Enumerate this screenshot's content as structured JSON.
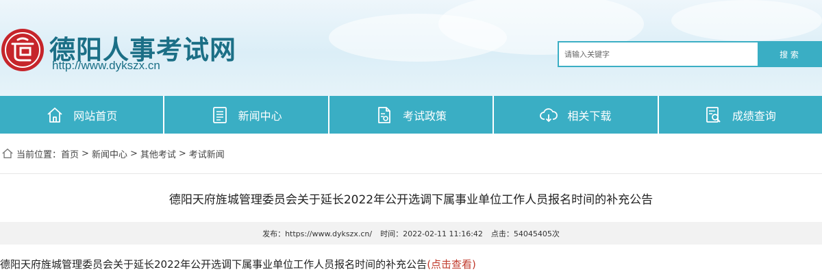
{
  "header": {
    "site_title": "德阳人事考试网",
    "site_url": "http://www.dykszx.cn",
    "logo_icon": "seal-logo-icon",
    "brand_color": "#1b6f86",
    "accent_color": "#3aaec4"
  },
  "search": {
    "placeholder": "请输入关键字",
    "button_label": "搜 索"
  },
  "nav": {
    "items": [
      {
        "label": "网站首页",
        "icon": "home-icon"
      },
      {
        "label": "新闻中心",
        "icon": "news-icon"
      },
      {
        "label": "考试政策",
        "icon": "policy-document-icon"
      },
      {
        "label": "相关下载",
        "icon": "cloud-download-icon"
      },
      {
        "label": "成绩查询",
        "icon": "search-document-icon"
      }
    ]
  },
  "breadcrumb": {
    "prefix": "当前位置：",
    "items": [
      "首页",
      "新闻中心",
      "其他考试",
      "考试新闻"
    ],
    "separator": ">"
  },
  "article": {
    "title": "德阳天府旌城管理委员会关于延长2022年公开选调下属事业单位工作人员报名时间的补充公告",
    "meta": {
      "publisher": "发布：https://www.dykszx.cn/",
      "time": "时间：2022-02-11 11:16:42",
      "clicks": "点击：54045405次"
    },
    "body_text": "德阳天府旌城管理委员会关于延长2022年公开选调下属事业单位工作人员报名时间的补充公告",
    "body_link": "(点击查看)"
  }
}
